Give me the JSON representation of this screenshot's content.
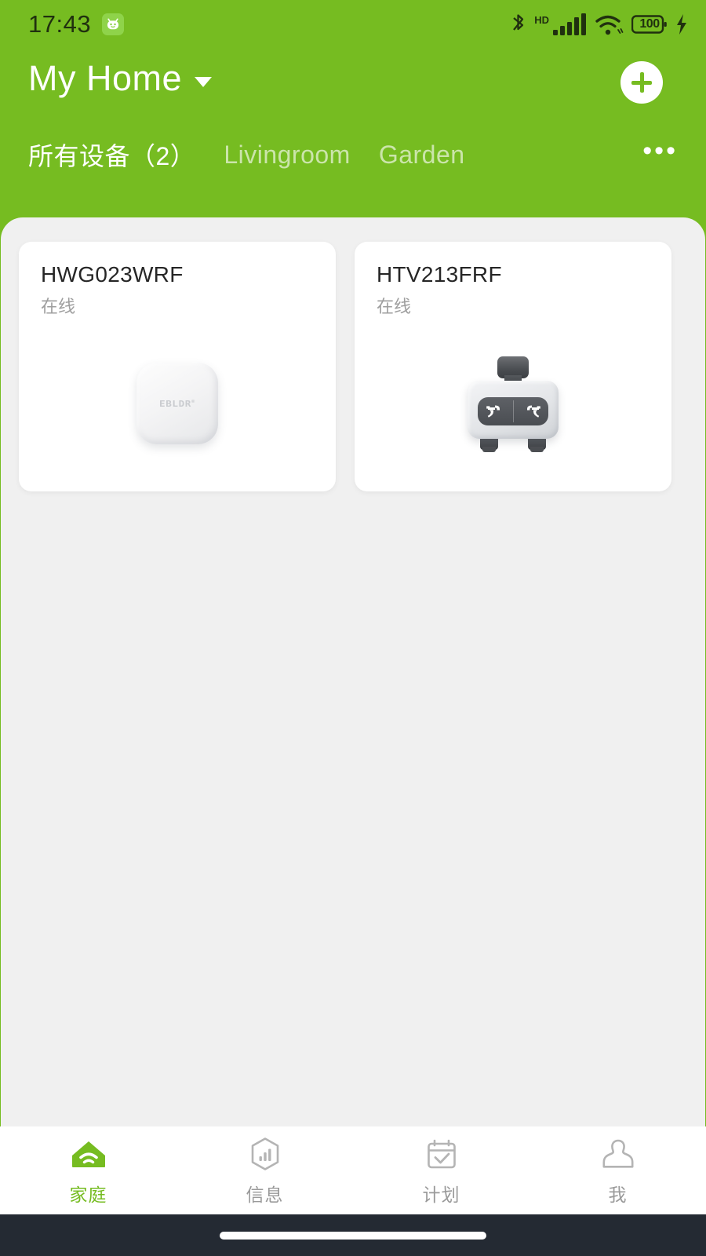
{
  "status_bar": {
    "time": "17:43",
    "badge_icon": "android-face-icon",
    "icons": [
      "bluetooth-icon",
      "hd-icon",
      "signal-bars-icon",
      "wifi-icon",
      "battery-icon",
      "charging-bolt-icon"
    ],
    "hd_label": "HD",
    "battery_level": "100"
  },
  "header": {
    "home_name": "My Home",
    "dropdown_icon": "chevron-down-icon",
    "add_button_icon": "plus-icon",
    "more_tabs_icon": "ellipsis-icon",
    "tabs": [
      {
        "label": "所有设备（2）",
        "active": true
      },
      {
        "label": "Livingroom",
        "active": false
      },
      {
        "label": "Garden",
        "active": false
      }
    ]
  },
  "devices": [
    {
      "name": "HWG023WRF",
      "status": "在线",
      "art": "gateway",
      "logo": "EBLDR"
    },
    {
      "name": "HTV213FRF",
      "status": "在线",
      "art": "valve",
      "logo": ""
    }
  ],
  "bottom_nav": [
    {
      "label": "家庭",
      "icon": "home-wifi-icon",
      "active": true
    },
    {
      "label": "信息",
      "icon": "hexagon-chart-icon",
      "active": false
    },
    {
      "label": "计划",
      "icon": "calendar-check-icon",
      "active": false
    },
    {
      "label": "我",
      "icon": "person-icon",
      "active": false
    }
  ],
  "colors": {
    "brand_green": "#76bc21",
    "panel_bg": "#f0f0f0",
    "card_bg": "#ffffff",
    "text_primary": "#262626",
    "text_muted": "#9e9e9e",
    "nav_inactive": "#9a9a9a",
    "gesture_bar": "#242a33"
  }
}
